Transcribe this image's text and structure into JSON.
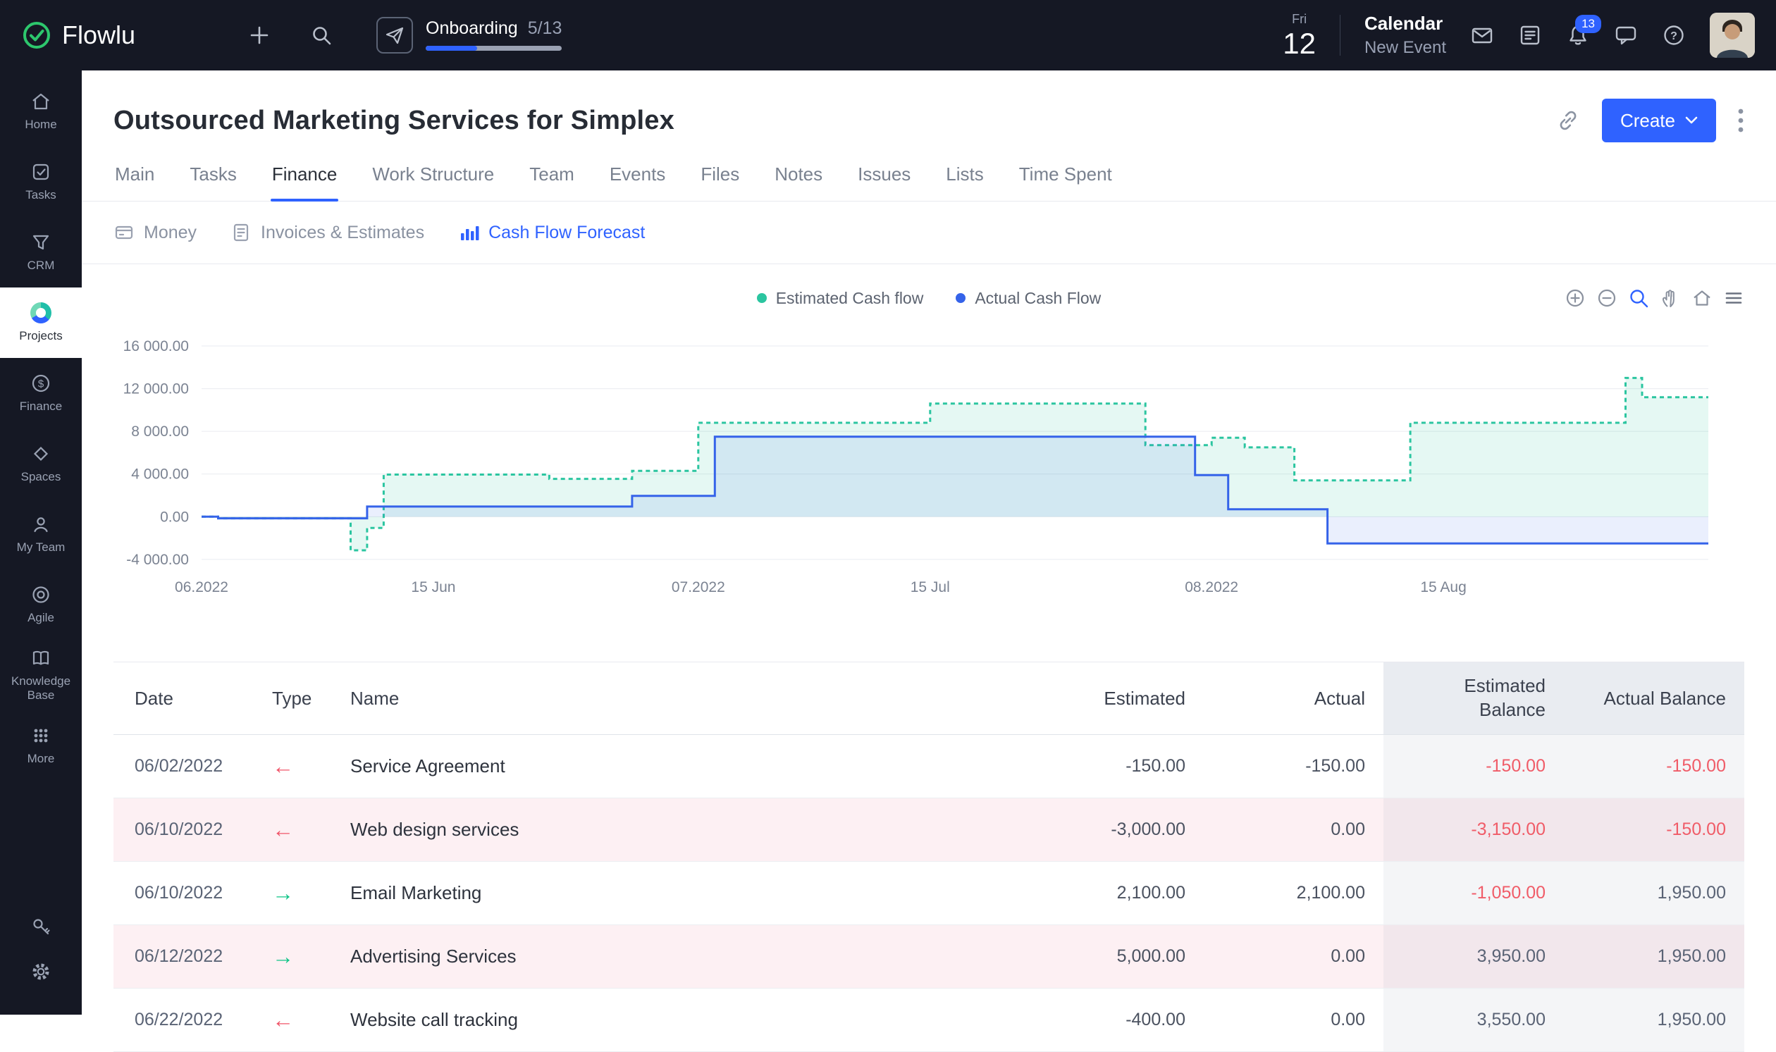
{
  "colors": {
    "accent": "#2f62ff",
    "negative": "#f05c68",
    "income_arrow": "#10c487",
    "expense_arrow": "#f0566a"
  },
  "topbar": {
    "logo_text": "Flowlu",
    "onboarding": {
      "label": "Onboarding",
      "progress_text": "5/13",
      "progress_pct": 38
    },
    "date": {
      "weekday": "Fri",
      "day": "12"
    },
    "calendar": {
      "title": "Calendar",
      "subtitle": "New Event"
    },
    "notifications_count": "13"
  },
  "sidebar": {
    "items": [
      {
        "label": "Home"
      },
      {
        "label": "Tasks"
      },
      {
        "label": "CRM"
      },
      {
        "label": "Projects"
      },
      {
        "label": "Finance"
      },
      {
        "label": "Spaces"
      },
      {
        "label": "My Team"
      },
      {
        "label": "Agile"
      },
      {
        "label": "Knowledge Base"
      },
      {
        "label": "More"
      }
    ]
  },
  "page": {
    "title": "Outsourced Marketing Services for Simplex",
    "create_label": "Create",
    "tabs": [
      "Main",
      "Tasks",
      "Finance",
      "Work Structure",
      "Team",
      "Events",
      "Files",
      "Notes",
      "Issues",
      "Lists",
      "Time Spent"
    ],
    "active_tab": "Finance",
    "subtabs": [
      "Money",
      "Invoices & Estimates",
      "Cash Flow Forecast"
    ],
    "active_subtab": "Cash Flow Forecast"
  },
  "chart_data": {
    "type": "area",
    "step": true,
    "legend": [
      {
        "label": "Estimated Cash flow",
        "color": "#2bc5a0"
      },
      {
        "label": "Actual Cash Flow",
        "color": "#3563e9"
      }
    ],
    "x_range": [
      0,
      91
    ],
    "x_ticks": [
      {
        "day": 0,
        "label": "06.2022"
      },
      {
        "day": 14,
        "label": "15 Jun"
      },
      {
        "day": 30,
        "label": "07.2022"
      },
      {
        "day": 44,
        "label": "15 Jul"
      },
      {
        "day": 61,
        "label": "08.2022"
      },
      {
        "day": 75,
        "label": "15 Aug"
      }
    ],
    "y_ticks": [
      16000,
      12000,
      8000,
      4000,
      0,
      -4000
    ],
    "y_tick_labels": [
      "16 000.00",
      "12 000.00",
      "8 000.00",
      "4 000.00",
      "0.00",
      "-4 000.00"
    ],
    "grid": true,
    "legend_position": "top-center",
    "series": [
      {
        "name": "Estimated Cash flow",
        "color": "#2bc5a0",
        "dash": true,
        "points": [
          [
            0,
            0
          ],
          [
            1,
            -150
          ],
          [
            9,
            -3150
          ],
          [
            10,
            -1050
          ],
          [
            11,
            3950
          ],
          [
            21,
            3550
          ],
          [
            26,
            4300
          ],
          [
            30,
            8800
          ],
          [
            44,
            10600
          ],
          [
            57,
            6700
          ],
          [
            61,
            7400
          ],
          [
            63,
            6500
          ],
          [
            66,
            3400
          ],
          [
            73,
            8800
          ],
          [
            86,
            13000
          ],
          [
            87,
            11200
          ],
          [
            91,
            11200
          ]
        ]
      },
      {
        "name": "Actual Cash Flow",
        "color": "#3563e9",
        "dash": false,
        "points": [
          [
            0,
            0
          ],
          [
            1,
            -150
          ],
          [
            10,
            950
          ],
          [
            26,
            1950
          ],
          [
            31,
            7500
          ],
          [
            60,
            3900
          ],
          [
            62,
            700
          ],
          [
            68,
            -2500
          ],
          [
            91,
            -2500
          ]
        ]
      }
    ]
  },
  "table": {
    "columns": [
      "Date",
      "Type",
      "Name",
      "Estimated",
      "Actual",
      "Estimated Balance",
      "Actual Balance"
    ],
    "rows": [
      {
        "date": "06/02/2022",
        "type": "out",
        "name": "Service Agreement",
        "estimated": "-150.00",
        "actual": "-150.00",
        "estimated_balance": "-150.00",
        "actual_balance": "-150.00"
      },
      {
        "date": "06/10/2022",
        "type": "out",
        "name": "Web design services",
        "estimated": "-3,000.00",
        "actual": "0.00",
        "estimated_balance": "-3,150.00",
        "actual_balance": "-150.00"
      },
      {
        "date": "06/10/2022",
        "type": "in",
        "name": "Email Marketing",
        "estimated": "2,100.00",
        "actual": "2,100.00",
        "estimated_balance": "-1,050.00",
        "actual_balance": "1,950.00"
      },
      {
        "date": "06/12/2022",
        "type": "in",
        "name": "Advertising Services",
        "estimated": "5,000.00",
        "actual": "0.00",
        "estimated_balance": "3,950.00",
        "actual_balance": "1,950.00"
      },
      {
        "date": "06/22/2022",
        "type": "out",
        "name": "Website call tracking",
        "estimated": "-400.00",
        "actual": "0.00",
        "estimated_balance": "3,550.00",
        "actual_balance": "1,950.00"
      }
    ]
  }
}
